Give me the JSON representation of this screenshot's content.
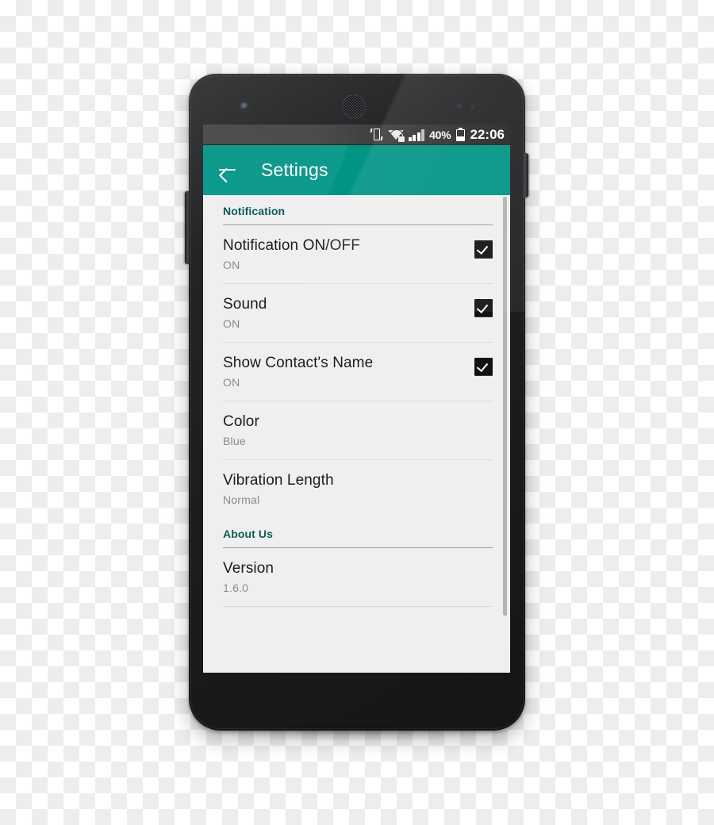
{
  "device": {
    "name": "android-smartphone",
    "front_camera": "front-camera",
    "earpiece": "earpiece-speaker",
    "power_button": "power-button",
    "volume_button": "volume-rocker"
  },
  "status_bar": {
    "vibrate_icon": "vibrate-icon",
    "wifi_icon": "wifi-secured-icon",
    "signal_icon": "cellular-signal-icon",
    "battery_percent": "40%",
    "battery_icon": "battery-icon",
    "battery_level": 40,
    "clock": "22:06"
  },
  "app_bar": {
    "back_icon": "back-arrow-icon",
    "title": "Settings",
    "background_color": "#009485"
  },
  "sections": [
    {
      "header": "Notification",
      "items": [
        {
          "title": "Notification ON/OFF",
          "subtitle": "ON",
          "checkbox": true,
          "checked": true
        },
        {
          "title": "Sound",
          "subtitle": "ON",
          "checkbox": true,
          "checked": true
        },
        {
          "title": "Show Contact's Name",
          "subtitle": "ON",
          "checkbox": true,
          "checked": true
        },
        {
          "title": "Color",
          "subtitle": "Blue",
          "checkbox": false,
          "checked": false
        },
        {
          "title": "Vibration Length",
          "subtitle": "Normal",
          "checkbox": false,
          "checked": false
        }
      ]
    },
    {
      "header": "About Us",
      "items": [
        {
          "title": "Version",
          "subtitle": "1.6.0",
          "checkbox": false,
          "checked": false
        }
      ]
    }
  ],
  "nav_bar": {
    "back": "nav-back-icon",
    "home": "nav-home-icon",
    "menu": "nav-menu-icon"
  },
  "colors": {
    "accent_teal": "#009485",
    "section_header_teal": "#0c5e52",
    "list_background": "#efefef",
    "title_text": "#1c1c1c",
    "subtitle_text": "#8b8b8b"
  }
}
